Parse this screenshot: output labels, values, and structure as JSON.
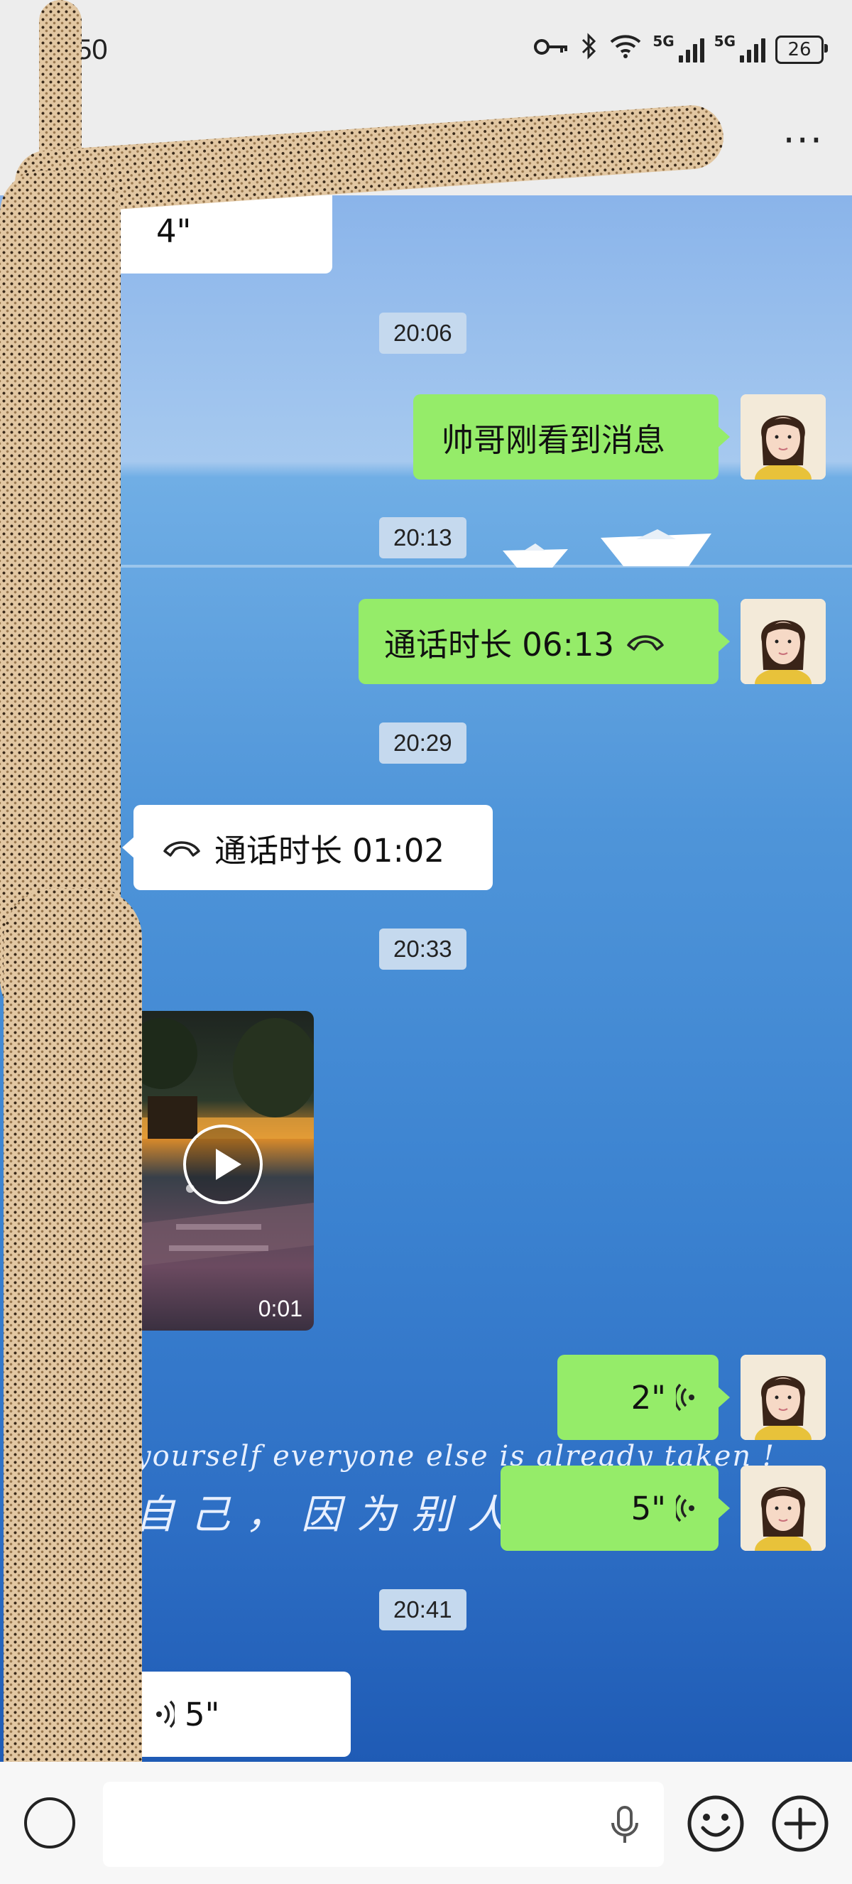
{
  "status": {
    "time": ":50",
    "net1": "5G",
    "net2": "5G",
    "battery": "26"
  },
  "header": {
    "title": "",
    "more": "···"
  },
  "messages": {
    "m0_duration": "4\"",
    "t1": "20:06",
    "m1_text": "帅哥刚看到消息",
    "t2": "20:13",
    "m2_text": "通话时长 06:13",
    "t3": "20:29",
    "m3_text": "通话时长 01:02",
    "t4": "20:33",
    "m4_video_duration": "0:01",
    "m5_duration": "2\"",
    "m6_duration": "5\"",
    "t5": "20:41",
    "m7_duration": "5\""
  },
  "background": {
    "line1": "yourself everyone else is already taken !",
    "line2": "自己，因为别人已"
  },
  "input": {
    "placeholder": ""
  },
  "colors": {
    "sent_bubble": "#95ec69",
    "received_bubble": "#ffffff",
    "timestamp_bg": "#c5d9ee"
  }
}
